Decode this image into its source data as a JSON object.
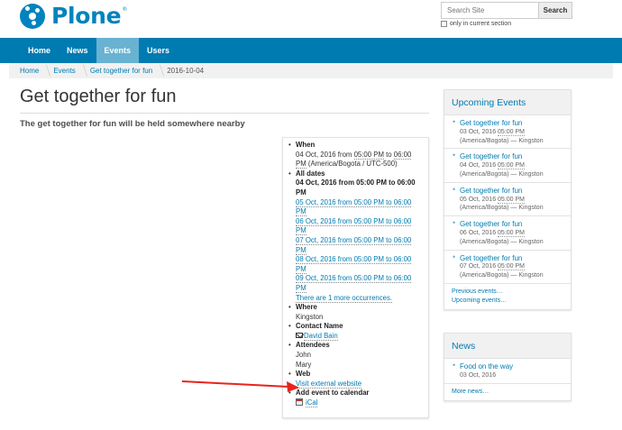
{
  "header": {
    "logo_text": "Plone",
    "logo_reg": "®",
    "search_placeholder": "Search Site",
    "search_button": "Search",
    "search_option": "only in current section"
  },
  "nav": {
    "items": [
      {
        "label": "Home"
      },
      {
        "label": "News"
      },
      {
        "label": "Events"
      },
      {
        "label": "Users"
      }
    ],
    "active": "Events"
  },
  "breadcrumb": {
    "items": [
      "Home",
      "Events",
      "Get together for fun"
    ],
    "current": "2016-10-04"
  },
  "page": {
    "title": "Get together for fun",
    "lead": "The get together for fun will be held somewhere nearby"
  },
  "details": {
    "when_label": "When",
    "when_date": "04 Oct, 2016 from ",
    "when_start": "05:00 PM",
    "when_to": " to ",
    "when_end": "06:00 PM",
    "when_tz": " (America/Bogota / UTC-500)",
    "alldates_label": "All dates",
    "alldates_first": "04 Oct, 2016 from 05:00 PM to 06:00 PM",
    "occurrences": [
      "05 Oct, 2016 from 05:00 PM to 06:00 PM",
      "06 Oct, 2016 from 05:00 PM to 06:00 PM",
      "07 Oct, 2016 from 05:00 PM to 06:00 PM",
      "08 Oct, 2016 from 05:00 PM to 06:00 PM",
      "09 Oct, 2016 from 05:00 PM to 06:00 PM"
    ],
    "more_occurrences": "There are 1 more occurrences.",
    "where_label": "Where",
    "where_value": "Kingston",
    "contact_label": "Contact Name",
    "contact_value": "David Bain",
    "attendees_label": "Attendees",
    "attendees": [
      "John",
      "Mary"
    ],
    "web_label": "Web",
    "web_value": "Visit external website",
    "calendar_label": "Add event to calendar",
    "calendar_value": "iCal"
  },
  "upcoming": {
    "title": "Upcoming Events",
    "items": [
      {
        "title": "Get together for fun",
        "date": "03 Oct, 2016 ",
        "time": "05:00 PM",
        "place": "(America/Bogota) — Kingston"
      },
      {
        "title": "Get together for fun",
        "date": "04 Oct, 2016 ",
        "time": "05:00 PM",
        "place": "(America/Bogota) — Kingston"
      },
      {
        "title": "Get together for fun",
        "date": "05 Oct, 2016 ",
        "time": "05:00 PM",
        "place": "(America/Bogota) — Kingston"
      },
      {
        "title": "Get together for fun",
        "date": "06 Oct, 2016 ",
        "time": "05:00 PM",
        "place": "(America/Bogota) — Kingston"
      },
      {
        "title": "Get together for fun",
        "date": "07 Oct, 2016 ",
        "time": "05:00 PM",
        "place": "(America/Bogota) — Kingston"
      }
    ],
    "previous_link": "Previous events…",
    "upcoming_link": "Upcoming events…"
  },
  "news": {
    "title": "News",
    "items": [
      {
        "title": "Food on the way",
        "date": "03 Oct, 2016"
      }
    ],
    "more_link": "More news…"
  },
  "colors": {
    "brand": "#0083be",
    "nav_bg": "#007bb1",
    "nav_active": "#69b2d2",
    "arrow": "#e8231c"
  }
}
